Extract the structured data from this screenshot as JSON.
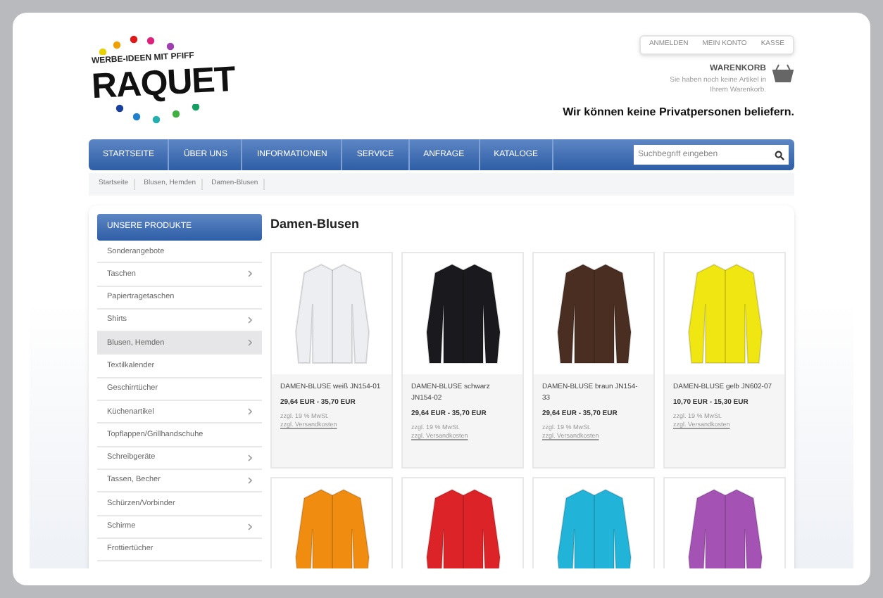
{
  "logo": {
    "tagline": "WERBE-IDEEN MIT PFIFF",
    "name": "RAQUET"
  },
  "account_links": [
    "ANMELDEN",
    "MEIN KONTO",
    "KASSE"
  ],
  "cart": {
    "title": "WARENKORB",
    "message": "Sie haben noch keine Artikel in Ihrem Warenkorb."
  },
  "notice": "Wir können keine Privatpersonen beliefern.",
  "nav": [
    {
      "label": "STARTSEITE"
    },
    {
      "label": "ÜBER UNS"
    },
    {
      "label": "INFORMATIONEN"
    },
    {
      "label": "SERVICE"
    },
    {
      "label": "ANFRAGE"
    },
    {
      "label": "KATALOGE"
    }
  ],
  "search": {
    "placeholder": "Suchbegriff eingeben"
  },
  "breadcrumbs": [
    "Startseite",
    "Blusen, Hemden",
    "Damen-Blusen"
  ],
  "sidebar": {
    "title": "UNSERE PRODUKTE",
    "items": [
      {
        "label": "Sonderangebote",
        "has_children": false,
        "selected": false
      },
      {
        "label": "Taschen",
        "has_children": true,
        "selected": false
      },
      {
        "label": "Papiertragetaschen",
        "has_children": false,
        "selected": false
      },
      {
        "label": "Shirts",
        "has_children": true,
        "selected": false
      },
      {
        "label": "Blusen, Hemden",
        "has_children": true,
        "selected": true
      },
      {
        "label": "Textilkalender",
        "has_children": false,
        "selected": false
      },
      {
        "label": "Geschirrtücher",
        "has_children": false,
        "selected": false
      },
      {
        "label": "Küchenartikel",
        "has_children": true,
        "selected": false
      },
      {
        "label": "Topflappen/Grillhandschuhe",
        "has_children": false,
        "selected": false
      },
      {
        "label": "Schreibgeräte",
        "has_children": true,
        "selected": false
      },
      {
        "label": "Tassen, Becher",
        "has_children": true,
        "selected": false
      },
      {
        "label": "Schürzen/Vorbinder",
        "has_children": false,
        "selected": false
      },
      {
        "label": "Schirme",
        "has_children": true,
        "selected": false
      },
      {
        "label": "Frottiertücher",
        "has_children": false,
        "selected": false
      }
    ]
  },
  "heading": "Damen-Blusen",
  "products": [
    {
      "color": "#eceef2",
      "name": "DAMEN-BLUSE weiß JN154-01",
      "price": "29,64 EUR - 35,70 EUR",
      "note": "zzgl. 19 % MwSt.",
      "link": "zzgl. Versandkosten"
    },
    {
      "color": "#1a1a1e",
      "name": "DAMEN-BLUSE schwarz JN154-02",
      "price": "29,64 EUR - 35,70 EUR",
      "note": "zzgl. 19 % MwSt.",
      "link": "zzgl. Versandkosten"
    },
    {
      "color": "#4a2e22",
      "name": "DAMEN-BLUSE braun JN154-33",
      "price": "29,64 EUR - 35,70 EUR",
      "note": "zzgl. 19 % MwSt.",
      "link": "zzgl. Versandkosten"
    },
    {
      "color": "#f0e612",
      "name": "DAMEN-BLUSE gelb JN602-07",
      "price": "10,70 EUR - 15,30 EUR",
      "note": "zzgl. 19 % MwSt.",
      "link": "zzgl. Versandkosten"
    },
    {
      "color": "#f08c10"
    },
    {
      "color": "#dc2428"
    },
    {
      "color": "#22b4d8"
    },
    {
      "color": "#a452b4"
    }
  ]
}
